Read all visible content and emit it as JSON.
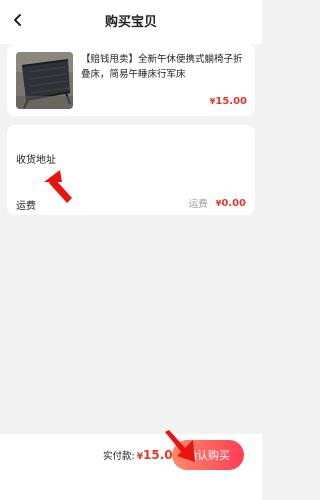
{
  "header": {
    "title": "购买宝贝",
    "back_icon": "chevron-left-icon"
  },
  "product": {
    "title": "【赔钱甩卖】全新午休便携式躺椅子折叠床，简易午睡床行军床",
    "price_symbol": "¥",
    "price": "15.00",
    "thumbnail": "folding-cot-image"
  },
  "order": {
    "address_label": "收货地址",
    "shipping_label": "运费",
    "shipping_sub_label": "运费",
    "shipping_price_symbol": "¥",
    "shipping_price": "0.00"
  },
  "footer": {
    "total_label": "实付款:",
    "total_symbol": "¥",
    "total_price": "15.00",
    "confirm_label": "确认购买"
  },
  "annotations": {
    "arrow_color": "#e8140f",
    "arrow_icon": "red-arrow-icon"
  },
  "colors": {
    "accent": "#e8352a",
    "button_gradient_start": "#ff8a6a",
    "button_gradient_end": "#ff3d57",
    "background": "#f2f2f2"
  }
}
